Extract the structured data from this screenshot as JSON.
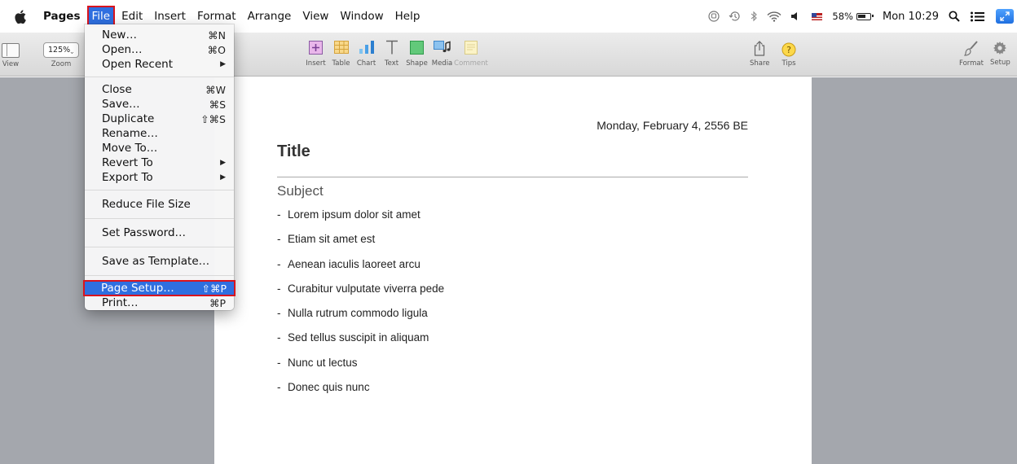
{
  "menubar": {
    "app_name": "Pages",
    "menus": [
      "File",
      "Edit",
      "Insert",
      "Format",
      "Arrange",
      "View",
      "Window",
      "Help"
    ],
    "active_menu": "File",
    "battery_percent": "58%",
    "clock": "Mon 10:29"
  },
  "toolbar": {
    "view_label": "View",
    "zoom_value": "125%",
    "zoom_label": "Zoom",
    "tools": [
      "Insert",
      "Table",
      "Chart",
      "Text",
      "Shape",
      "Media",
      "Comment"
    ],
    "share_label": "Share",
    "tips_label": "Tips",
    "format_label": "Format",
    "setup_label": "Setup"
  },
  "file_menu": {
    "new": {
      "label": "New…",
      "shortcut": "⌘N"
    },
    "open": {
      "label": "Open…",
      "shortcut": "⌘O"
    },
    "open_recent": {
      "label": "Open Recent"
    },
    "close": {
      "label": "Close",
      "shortcut": "⌘W"
    },
    "save": {
      "label": "Save…",
      "shortcut": "⌘S"
    },
    "duplicate": {
      "label": "Duplicate",
      "shortcut": "⇧⌘S"
    },
    "rename": {
      "label": "Rename…"
    },
    "move_to": {
      "label": "Move To…"
    },
    "revert_to": {
      "label": "Revert To"
    },
    "export_to": {
      "label": "Export To"
    },
    "reduce_file_size": {
      "label": "Reduce File Size"
    },
    "set_password": {
      "label": "Set Password…"
    },
    "save_as_template": {
      "label": "Save as Template…"
    },
    "page_setup": {
      "label": "Page Setup…",
      "shortcut": "⇧⌘P"
    },
    "print": {
      "label": "Print…",
      "shortcut": "⌘P"
    }
  },
  "document": {
    "date": "Monday, February 4, 2556 BE",
    "title": "Title",
    "subject": "Subject",
    "bullets": [
      "Lorem ipsum dolor sit amet",
      "Etiam sit amet est",
      "Aenean iaculis laoreet arcu",
      "Curabitur vulputate viverra pede",
      "Nulla rutrum commodo ligula",
      "Sed tellus suscipit in aliquam",
      "Nunc ut lectus",
      "Donec quis nunc"
    ]
  }
}
